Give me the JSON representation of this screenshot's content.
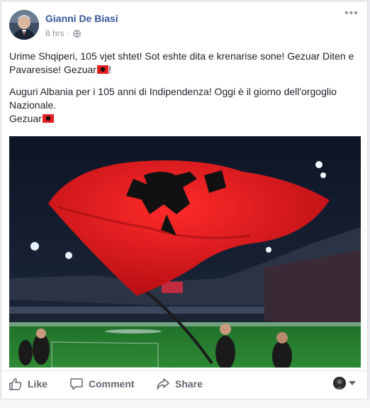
{
  "post": {
    "author": "Gianni De Biasi",
    "time": "8 hrs",
    "privacy_icon": "globe-icon",
    "text_line1": "Urime Shqiperi, 105 vjet shtet! Sot eshte dita e krenarise sone! Gezuar Diten e Pavaresise! Gezuar",
    "text_line1_end": "!",
    "text_line2": "Auguri Albania per i 105 anni di Indipendenza! Oggi è il giorno dell'orgoglio Nazionale.",
    "text_line3": "Gezuar",
    "flag_emoji": "albania-flag-emoji",
    "image": "photo-albanian-flag-stadium"
  },
  "actions": {
    "like": "Like",
    "comment": "Comment",
    "share": "Share"
  },
  "colors": {
    "author_link": "#365899",
    "flag_red": "#e41e20",
    "action_gray": "#606770"
  }
}
